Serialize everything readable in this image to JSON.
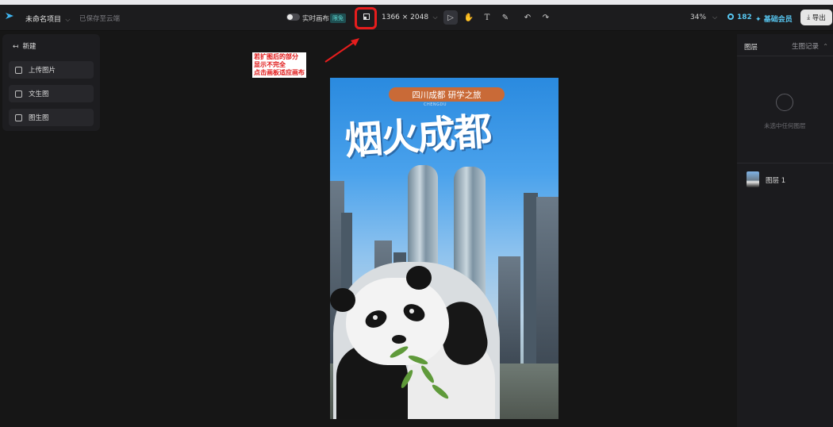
{
  "topbar": {
    "project_name": "未命名项目",
    "save_status": "已保存至云端",
    "live_canvas_label": "实时画布",
    "live_canvas_badge": "限免",
    "canvas_size": "1366 × 2048",
    "zoom": "34%",
    "credits": "182",
    "membership": "基础会员",
    "export_label": "导出"
  },
  "left_panel": {
    "new_label": "新建",
    "buttons": [
      {
        "label": "上传图片"
      },
      {
        "label": "文生图"
      },
      {
        "label": "图生图"
      }
    ]
  },
  "right_panel": {
    "title": "图层",
    "history_label": "生图记录",
    "empty_text": "未选中任何图层",
    "layers": [
      {
        "name": "图层 1"
      }
    ]
  },
  "annotation": {
    "lines": [
      "若扩图后的部分",
      "显示不完全",
      "点击画板适应画布"
    ],
    "color": "#e01818"
  },
  "poster": {
    "pill_text": "四川成都  研学之旅",
    "pill_sub": "CHENGDU",
    "title": "烟火成都"
  },
  "colors": {
    "accent": "#57c6f0",
    "highlight_box": "#e61d1d",
    "background": "#161616"
  },
  "icons": [
    "logo-icon",
    "chevron-down-icon",
    "fit-canvas-icon",
    "select-icon",
    "hand-icon",
    "text-icon",
    "brush-icon",
    "undo-icon",
    "redo-icon",
    "credit-icon",
    "sparkle-icon",
    "export-icon",
    "back-icon",
    "upload-icon",
    "text-to-image-icon",
    "image-to-image-icon",
    "layers-empty-icon"
  ]
}
